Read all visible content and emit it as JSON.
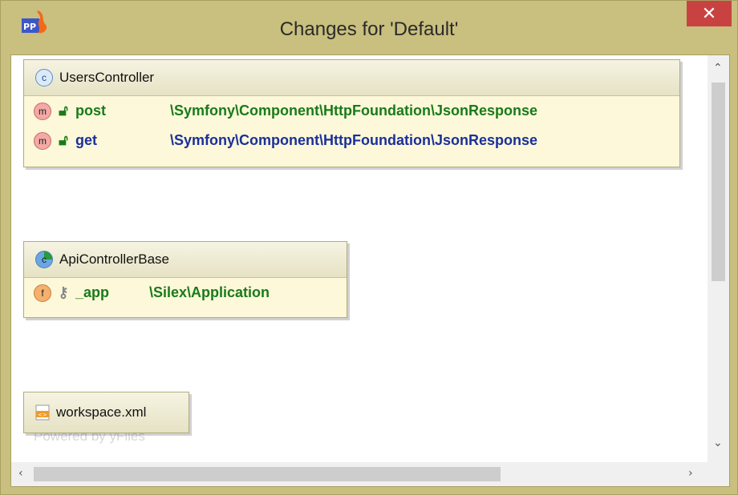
{
  "window": {
    "title": "Changes for 'Default'"
  },
  "nodes": {
    "users_controller": {
      "name": "UsersController",
      "methods": [
        {
          "name": "post",
          "return_type": "\\Symfony\\Component\\HttpFoundation\\JsonResponse"
        },
        {
          "name": "get",
          "return_type": "\\Symfony\\Component\\HttpFoundation\\JsonResponse"
        }
      ]
    },
    "api_controller_base": {
      "name": "ApiControllerBase",
      "fields": [
        {
          "name": "_app",
          "type": "\\Silex\\Application"
        }
      ]
    },
    "workspace_file": {
      "name": "workspace.xml"
    }
  },
  "badges": {
    "class": "c",
    "method": "m",
    "field": "f"
  },
  "watermark": "Powered by yFiles",
  "colors": {
    "node_bg": "#fcf8d9",
    "close_button": "#c94242",
    "type_blue": "#1b2f9a",
    "green": "#1a7a1a"
  },
  "icons": [
    "app-icon",
    "close-icon",
    "class-icon",
    "method-icon",
    "field-icon",
    "public-lock-icon",
    "private-key-icon",
    "xml-file-icon",
    "scroll-up-icon",
    "scroll-down-icon",
    "scroll-left-icon",
    "scroll-right-icon"
  ]
}
